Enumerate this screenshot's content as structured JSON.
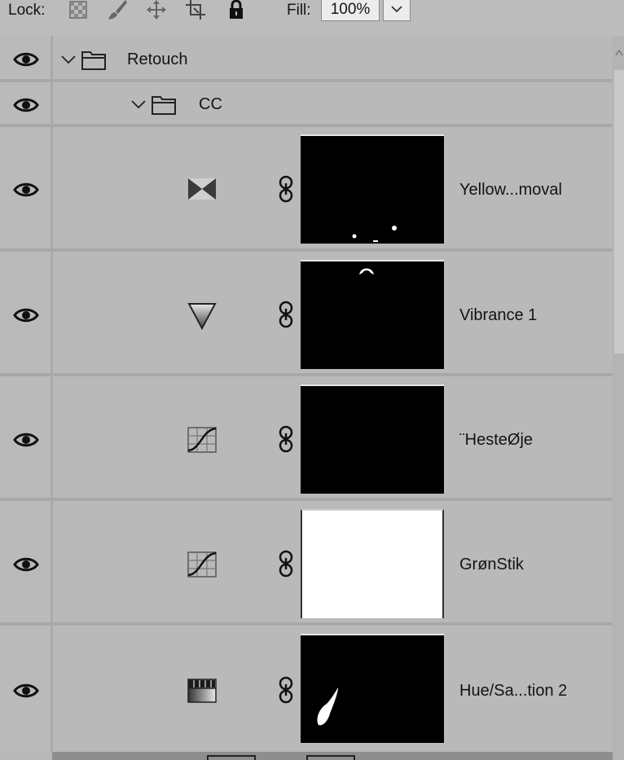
{
  "toolbar": {
    "lock_label": "Lock:",
    "lock_icons": [
      "lock-transparent-pixels-icon",
      "lock-image-pixels-icon",
      "lock-position-icon",
      "lock-artboard-icon",
      "lock-all-icon"
    ],
    "fill_label": "Fill:",
    "fill_value": "100%"
  },
  "layers": {
    "groups": [
      {
        "name": "Retouch",
        "expanded": true
      },
      {
        "name": "CC",
        "expanded": true
      }
    ],
    "items": [
      {
        "name": "Yellow...moval",
        "type": "selective-color-icon",
        "mask": "black"
      },
      {
        "name": "Vibrance 1",
        "type": "vibrance-icon",
        "mask": "black"
      },
      {
        "name": "¨HesteØje",
        "type": "curves-icon",
        "mask": "black"
      },
      {
        "name": "GrønStik",
        "type": "curves-icon",
        "mask": "white"
      },
      {
        "name": "Hue/Sa...tion 2",
        "type": "hue-saturation-icon",
        "mask": "black"
      }
    ]
  }
}
